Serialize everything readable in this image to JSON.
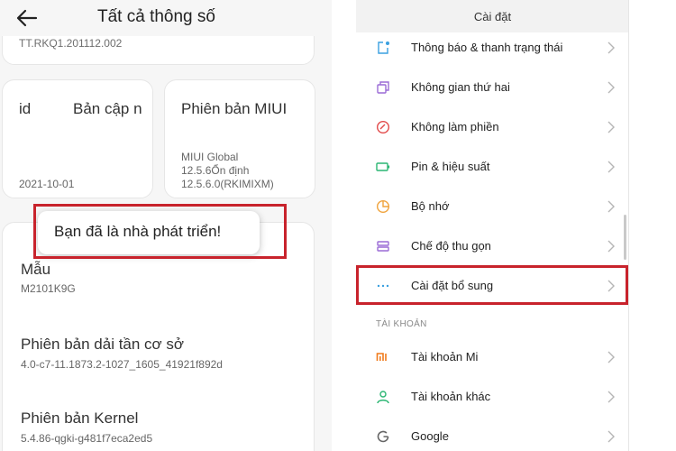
{
  "colors": {
    "highlight": "#c8232c",
    "toast_bg": "#ffffff"
  },
  "left": {
    "header": {
      "back_icon": "back-arrow-icon",
      "title": "Tất cả thông số"
    },
    "top_card_text": "TT.RKQ1.201112.002",
    "card_android": {
      "label": "id",
      "update_label": "Bản cập n",
      "date": "2021-10-01"
    },
    "card_miui": {
      "title": "Phiên bản MIUI",
      "line1": "MIUI Global",
      "line2": "12.5.6Ổn định",
      "line3": "12.5.6.0(RKIMIXM)"
    },
    "toast": "Bạn đã là nhà phát triển!",
    "details": [
      {
        "title": "Mẫu",
        "value": "M2101K9G"
      },
      {
        "title": "Phiên bản dải tần cơ sở",
        "value": "4.0-c7-11.1873.2-1027_1605_41921f892d"
      },
      {
        "title": "Phiên bản Kernel",
        "value": "5.4.86-qgki-g481f7eca2ed5"
      }
    ]
  },
  "right": {
    "header_title": "Cài đặt",
    "items": [
      {
        "label": "Thông báo & thanh trạng thái",
        "icon": "notification-icon",
        "color": "#3aa0e0"
      },
      {
        "label": "Không gian thứ hai",
        "icon": "second-space-icon",
        "color": "#9b6bd6"
      },
      {
        "label": "Không làm phiền",
        "icon": "do-not-disturb-icon",
        "color": "#e24a4a"
      },
      {
        "label": "Pin & hiệu suất",
        "icon": "battery-icon",
        "color": "#2bb673"
      },
      {
        "label": "Bộ nhớ",
        "icon": "storage-icon",
        "color": "#f0a33c"
      },
      {
        "label": "Chế độ thu gọn",
        "icon": "compact-mode-icon",
        "color": "#9b6bd6"
      },
      {
        "label": "Cài đặt bổ sung",
        "icon": "more-icon",
        "color": "#3aa0e0"
      }
    ],
    "section_label": "TÀI KHOẢN",
    "account_items": [
      {
        "label": "Tài khoản Mi",
        "icon": "mi-icon",
        "color": "#f07a1a"
      },
      {
        "label": "Tài khoản khác",
        "icon": "user-icon",
        "color": "#2bb673"
      },
      {
        "label": "Google",
        "icon": "google-icon",
        "color": "#666666"
      }
    ]
  }
}
